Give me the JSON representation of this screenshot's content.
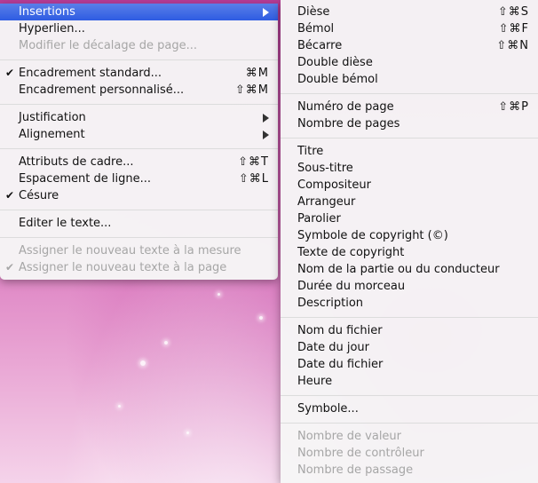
{
  "main_menu": {
    "items": [
      {
        "label": "Insertions",
        "shortcut": "",
        "check": ""
      },
      {
        "label": "Hyperlien...",
        "shortcut": "",
        "check": ""
      },
      {
        "label": "Modifier le décalage de page...",
        "shortcut": "",
        "check": ""
      },
      {
        "label": "Encadrement standard...",
        "shortcut": "⌘M",
        "check": "✔"
      },
      {
        "label": "Encadrement personnalisé...",
        "shortcut": "⇧⌘M",
        "check": ""
      },
      {
        "label": "Justification",
        "shortcut": "",
        "check": ""
      },
      {
        "label": "Alignement",
        "shortcut": "",
        "check": ""
      },
      {
        "label": "Attributs de cadre...",
        "shortcut": "⇧⌘T",
        "check": ""
      },
      {
        "label": "Espacement de ligne...",
        "shortcut": "⇧⌘L",
        "check": ""
      },
      {
        "label": "Césure",
        "shortcut": "",
        "check": "✔"
      },
      {
        "label": "Editer le texte...",
        "shortcut": "",
        "check": ""
      },
      {
        "label": "Assigner le nouveau texte à la mesure",
        "shortcut": "",
        "check": ""
      },
      {
        "label": "Assigner le nouveau texte à la page",
        "shortcut": "",
        "check": "✔"
      }
    ]
  },
  "sub_menu": {
    "items": [
      {
        "label": "Dièse",
        "shortcut": "⇧⌘S"
      },
      {
        "label": "Bémol",
        "shortcut": "⇧⌘F"
      },
      {
        "label": "Bécarre",
        "shortcut": "⇧⌘N"
      },
      {
        "label": "Double dièse",
        "shortcut": ""
      },
      {
        "label": "Double bémol",
        "shortcut": ""
      },
      {
        "label": "Numéro de page",
        "shortcut": "⇧⌘P"
      },
      {
        "label": "Nombre de pages",
        "shortcut": ""
      },
      {
        "label": "Titre",
        "shortcut": ""
      },
      {
        "label": "Sous-titre",
        "shortcut": ""
      },
      {
        "label": "Compositeur",
        "shortcut": ""
      },
      {
        "label": "Arrangeur",
        "shortcut": ""
      },
      {
        "label": "Parolier",
        "shortcut": ""
      },
      {
        "label": "Symbole de copyright (©)",
        "shortcut": ""
      },
      {
        "label": "Texte de copyright",
        "shortcut": ""
      },
      {
        "label": "Nom de la partie ou du conducteur",
        "shortcut": ""
      },
      {
        "label": "Durée du morceau",
        "shortcut": ""
      },
      {
        "label": "Description",
        "shortcut": ""
      },
      {
        "label": "Nom du fichier",
        "shortcut": ""
      },
      {
        "label": "Date du jour",
        "shortcut": ""
      },
      {
        "label": "Date du fichier",
        "shortcut": ""
      },
      {
        "label": "Heure",
        "shortcut": ""
      },
      {
        "label": "Symbole...",
        "shortcut": ""
      },
      {
        "label": "Nombre de valeur",
        "shortcut": ""
      },
      {
        "label": "Nombre de contrôleur",
        "shortcut": ""
      },
      {
        "label": "Nombre de passage",
        "shortcut": ""
      }
    ]
  }
}
